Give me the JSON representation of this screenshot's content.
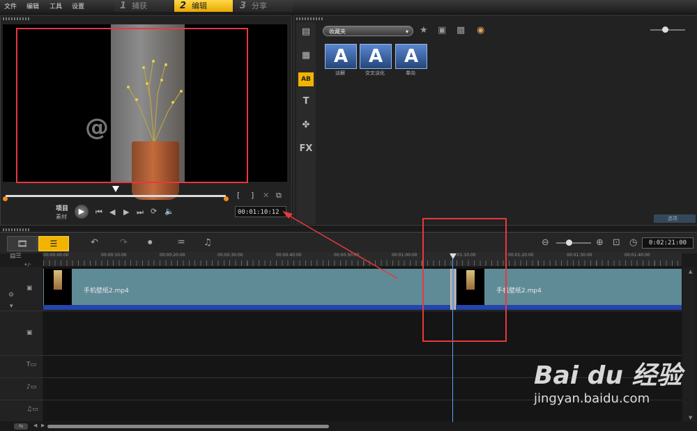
{
  "menu": {
    "file": "文件",
    "edit": "编辑",
    "tools": "工具",
    "settings": "设置"
  },
  "steps": [
    {
      "num": "1",
      "label": "捕获"
    },
    {
      "num": "2",
      "label": "编辑"
    },
    {
      "num": "3",
      "label": "分享"
    }
  ],
  "preview": {
    "mode_project": "项目",
    "mode_clip": "素材",
    "timecode": "00:01:10:12",
    "mark_in": "[",
    "mark_out": "]"
  },
  "library": {
    "folder": "收藏夹",
    "options": "选项",
    "transitions": [
      {
        "glyph": "A",
        "label": "淡解"
      },
      {
        "glyph": "A",
        "label": "交叉淡化"
      },
      {
        "glyph": "A",
        "label": "单向"
      }
    ],
    "tool_text": "T",
    "tool_fx": "FX",
    "tool_ab": "AB"
  },
  "timeline": {
    "timecode": "0:02:21:00",
    "ruler": [
      "00:00:00:00",
      "00:00:10:00",
      "00:00:20:00",
      "00:00:30:00",
      "00:00:40:00",
      "00:00:50:00",
      "00:01:00:00",
      "00:01:10:00",
      "00:01:20:00",
      "00:01:30:00",
      "00:01:40:00"
    ],
    "clips": [
      {
        "name": "手机壁纸2.mp4"
      },
      {
        "name": "手机壁纸2.mp4"
      }
    ]
  },
  "colors": {
    "accent": "#f2b400",
    "annotation": "#e8383d",
    "clip": "#5f8b97",
    "playhead": "#5aa4ff"
  },
  "watermark": {
    "logo": "Bai du 经验",
    "url": "jingyan.baidu.com"
  }
}
